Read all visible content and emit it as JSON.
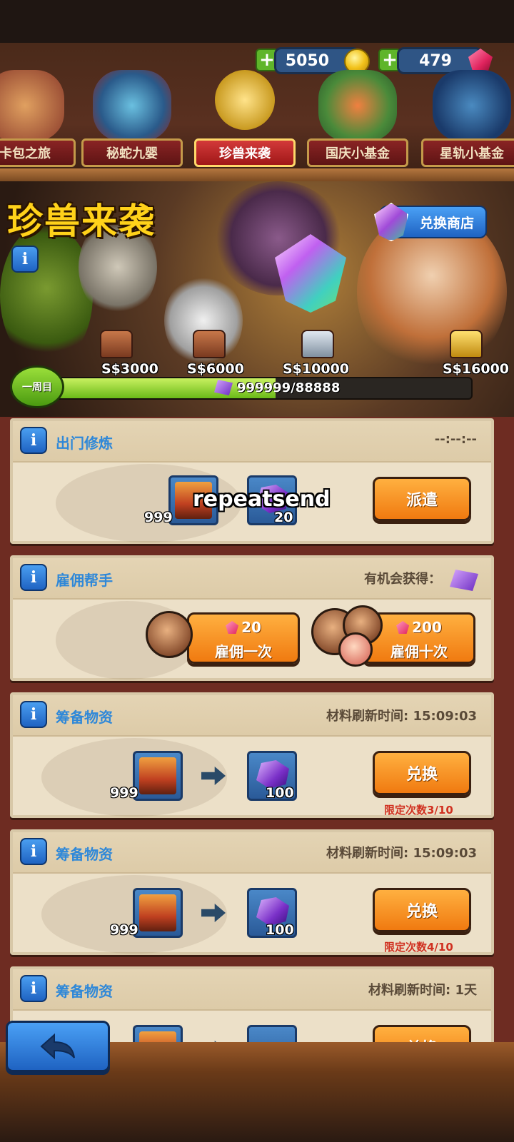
{
  "currency": {
    "gold": "5050",
    "gems": "479"
  },
  "tabs": [
    {
      "label": "卡包之旅",
      "active": false
    },
    {
      "label": "秘蛇九婴",
      "active": false
    },
    {
      "label": "珍兽来袭",
      "active": true
    },
    {
      "label": "国庆小基金",
      "active": false
    },
    {
      "label": "星轨小基金",
      "active": false
    }
  ],
  "banner": {
    "title": "珍兽来袭",
    "shop_label": "兑换商店"
  },
  "milestones": [
    "S$3000",
    "S$6000",
    "S$10000",
    "S$16000"
  ],
  "progress": {
    "round_label": "一周目",
    "text": "999999/88888",
    "fill_fraction": 0.55
  },
  "cards": {
    "dispatch": {
      "title": "出门修炼",
      "right": "--:--:--",
      "item_count": "999",
      "reward_count": "20",
      "button": "派遣",
      "overlay_text": "repeatsend"
    },
    "hire": {
      "title": "雇佣帮手",
      "right": "有机会获得：",
      "single_cost": "20",
      "single_label": "雇佣一次",
      "ten_cost": "200",
      "ten_label": "雇佣十次"
    },
    "prepare1": {
      "title": "筹备物资",
      "right": "材料刷新时间: 15:09:03",
      "item_count": "999",
      "reward_count": "100",
      "button": "兑换",
      "limit": "限定次数3/10"
    },
    "prepare2": {
      "title": "筹备物资",
      "right": "材料刷新时间: 15:09:03",
      "item_count": "999",
      "reward_count": "100",
      "button": "兑换",
      "limit": "限定次数4/10"
    },
    "prepare3": {
      "title": "筹备物资",
      "right": "材料刷新时间: 1天",
      "button": "兑换"
    }
  },
  "icons": {
    "info": "i",
    "back": "back-arrow-icon"
  },
  "colors": {
    "accent_blue": "#2f88d8",
    "button_orange": "#f07a10",
    "progress_green": "#6aba18",
    "limit_red": "#d03020",
    "title_yellow": "#ffd21a"
  }
}
